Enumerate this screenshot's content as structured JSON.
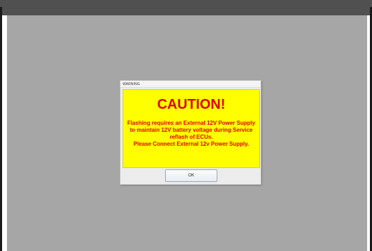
{
  "dialog": {
    "title": "WARNING",
    "heading": "CAUTION!",
    "message_lines": [
      "Flashing requires an External 12V Power Supply",
      "to maintain 12V battery voltage during Service",
      "reflash of ECUs.",
      "Please Connect External 12v Power Supply."
    ],
    "ok_label": "OK"
  },
  "colors": {
    "warning_background": "#ffff00",
    "warning_text": "#e00000",
    "backdrop": "#a6a6a6",
    "topbar": "#505050"
  }
}
